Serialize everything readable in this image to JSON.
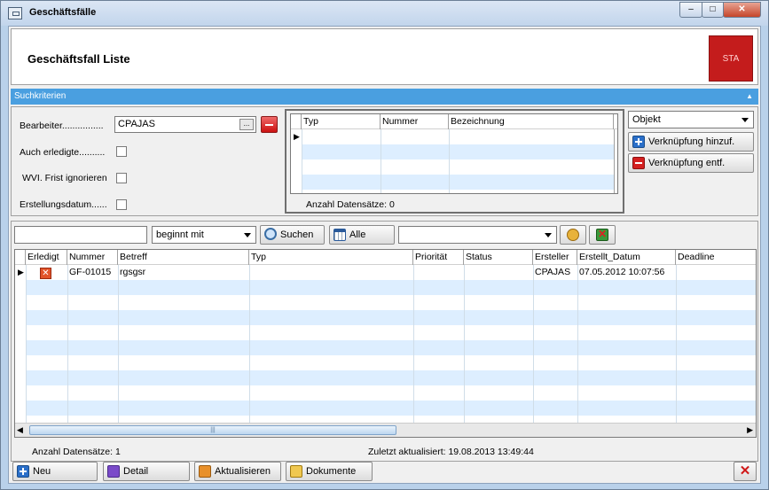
{
  "window": {
    "title": "Geschäftsfälle",
    "min": "–",
    "max": "□",
    "close": "✕"
  },
  "header": {
    "title": "Geschäftsfall Liste",
    "badge": "STA"
  },
  "criteria": {
    "title": "Suchkriterien",
    "bearbeiter_label": "Bearbeiter................",
    "bearbeiter_value": "CPAJAS",
    "ellipsis": "...",
    "auch_erledigte_label": "Auch erledigte..........",
    "wvl_label": "WVI. Frist ignorieren",
    "erstellungsdatum_label": "Erstellungsdatum......"
  },
  "link_grid": {
    "columns": [
      "Typ",
      "Nummer",
      "Bezeichnung"
    ],
    "status": "Anzahl Datensätze: 0"
  },
  "link_panel": {
    "object_select": "Objekt",
    "add_label": "Verknüpfung hinzuf.",
    "remove_label": "Verknüpfung entf."
  },
  "toolbar": {
    "search_value": "",
    "match_mode": "beginnt mit",
    "search_label": "Suchen",
    "all_label": "Alle",
    "filter_value": ""
  },
  "main_grid": {
    "columns": [
      "Erledigt",
      "Nummer",
      "Betreff",
      "Typ",
      "Priorität",
      "Status",
      "Ersteller",
      "Erstellt_Datum",
      "Deadline"
    ],
    "rows": [
      {
        "erledigt": "✕",
        "nummer": "GF-01015",
        "betreff": "rgsgsr",
        "typ": "",
        "prioritaet": "",
        "status": "",
        "ersteller": "CPAJAS",
        "erstellt_datum": "07.05.2012 10:07:56",
        "deadline": ""
      }
    ],
    "hscroll_grip": "|||"
  },
  "status": {
    "count": "Anzahl Datensätze: 1",
    "updated": "Zuletzt aktualisiert: 19.08.2013 13:49:44"
  },
  "footer": {
    "new_label": "Neu",
    "detail_label": "Detail",
    "refresh_label": "Aktualisieren",
    "docs_label": "Dokumente"
  },
  "colors": {
    "accent": "#4a9fe0",
    "alt_row": "#ddeeff",
    "badge": "#c41c1c"
  }
}
